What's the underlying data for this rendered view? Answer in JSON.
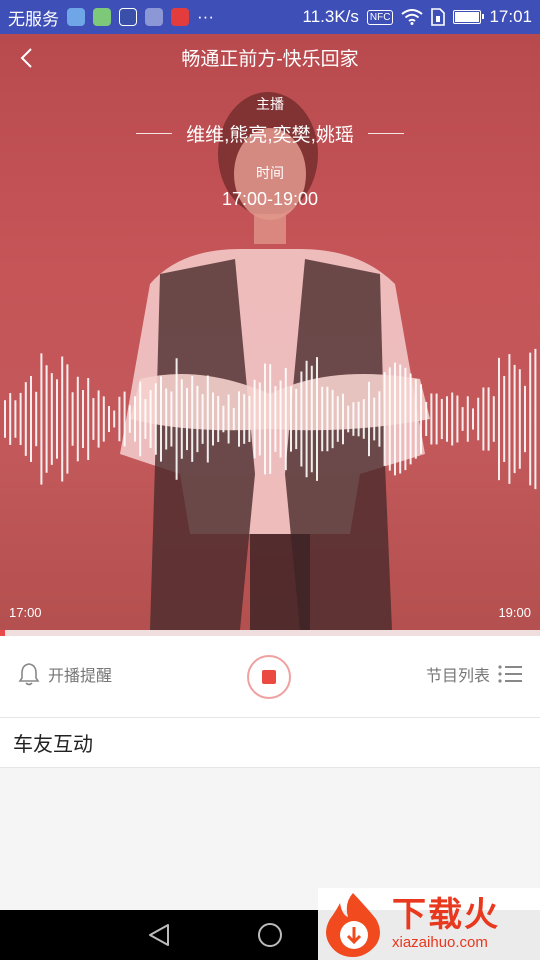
{
  "status_bar": {
    "carrier": "无服务",
    "speed": "11.3K/s",
    "nfc": "NFC",
    "time": "17:01",
    "battery_level": 0.9
  },
  "header": {
    "title": "畅通正前方-快乐回家",
    "back_icon": "chevron-left-icon"
  },
  "program": {
    "host_label": "主播",
    "hosts": "维维,熊亮,奕樊,姚瑶",
    "time_label": "时间",
    "time_range": "17:00-19:00",
    "start_time": "17:00",
    "end_time": "19:00",
    "progress": 0.01
  },
  "controls": {
    "remind_label": "开播提醒",
    "remind_icon": "bell-icon",
    "stop_icon": "stop-icon",
    "playlist_label": "节目列表",
    "playlist_icon": "list-icon"
  },
  "section": {
    "title": "车友互动"
  },
  "nav": {
    "back_icon": "triangle-back-icon",
    "home_icon": "circle-home-icon"
  },
  "watermark": {
    "brand": "下载火",
    "url": "xiazaihuo.com"
  },
  "colors": {
    "status_bar": "#3f4fb8",
    "hero_tint": "#c65558",
    "accent": "#e84a4a"
  }
}
